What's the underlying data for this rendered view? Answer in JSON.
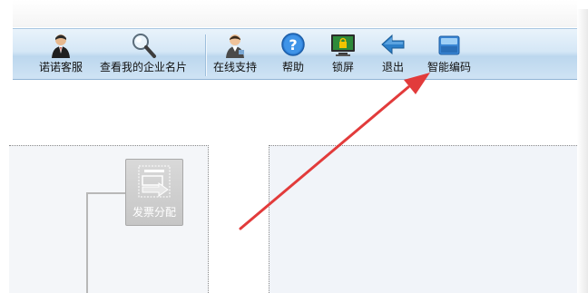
{
  "toolbar": {
    "buttons": [
      {
        "label": "诺诺客服",
        "icon": "customer-service-agent-icon"
      },
      {
        "label": "查看我的企业名片",
        "icon": "magnifier-icon"
      },
      {
        "label": "在线支持",
        "icon": "online-support-person-icon"
      },
      {
        "label": "帮助",
        "icon": "help-question-icon"
      },
      {
        "label": "锁屏",
        "icon": "lock-screen-monitor-icon"
      },
      {
        "label": "退出",
        "icon": "exit-arrow-icon"
      },
      {
        "label": "智能编码",
        "icon": "smart-coding-window-icon"
      }
    ]
  },
  "workflow": {
    "node_label": "发票分配",
    "node_icon": "invoice-allocation-icon"
  },
  "colors": {
    "toolbar_top": "#e9f3fb",
    "toolbar_bottom": "#bcd7ee",
    "annotation_arrow": "#e23b3b",
    "node_bg": "#cfcfcf"
  }
}
